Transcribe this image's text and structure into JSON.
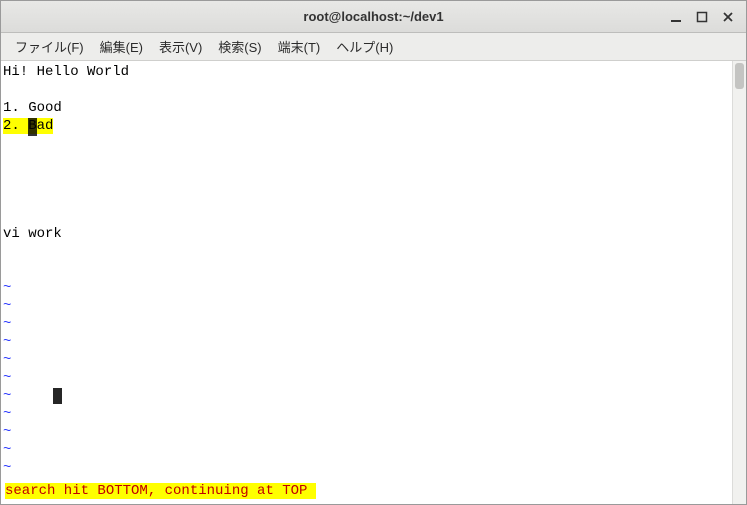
{
  "window": {
    "title": "root@localhost:~/dev1"
  },
  "menu": {
    "file": "ファイル(F)",
    "edit": "編集(E)",
    "view": "表示(V)",
    "search": "検索(S)",
    "terminal": "端末(T)",
    "help": "ヘルプ(H)"
  },
  "buffer": {
    "line1": "Hi! Hello World",
    "line2": "",
    "line3": "1. Good",
    "line4_pre": "2. ",
    "line4_cursor": "B",
    "line4_post": "ad",
    "line5": "",
    "line6": "",
    "line7": "",
    "line8": "",
    "line9": "",
    "line10": "vi work",
    "line11": "",
    "tilde": "~",
    "status": "search hit BOTTOM, continuing at TOP "
  },
  "colors": {
    "highlight": "#ffff00",
    "tilde": "#2e3cff",
    "status_fg": "#c00000"
  }
}
